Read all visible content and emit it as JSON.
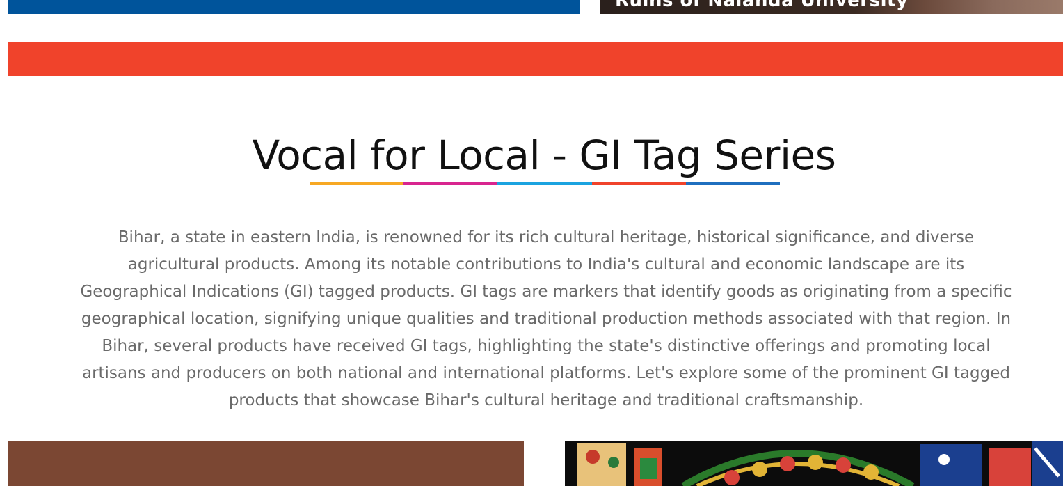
{
  "banner": {
    "caption": "Ruins of Nalanda University"
  },
  "section": {
    "title": "Vocal for Local - GI Tag Series",
    "underline_colors": [
      "#f7a823",
      "#d8258f",
      "#1ba3e0",
      "#f0432b",
      "#1f6fbf"
    ],
    "intro": "Bihar, a state in eastern India, is renowned for its rich cultural heritage, historical significance, and diverse\nagricultural products. Among its notable contributions to India's cultural and economic landscape are its\nGeographical Indications (GI) tagged products. GI tags are markers that identify goods as originating from a specific\ngeographical location, signifying unique qualities and traditional production methods associated with that region. In\nBihar, several products have received GI tags, highlighting the state's distinctive offerings and promoting local\nartisans and producers on both national and international platforms. Let's explore some of the prominent GI tagged\nproducts that showcase Bihar's cultural heritage and traditional craftsmanship."
  },
  "colors": {
    "top_blue": "#00549b",
    "red_bar": "#f0432b",
    "card_left": "#7b4733",
    "title_text": "#111111",
    "body_text": "#6a6a6a"
  }
}
